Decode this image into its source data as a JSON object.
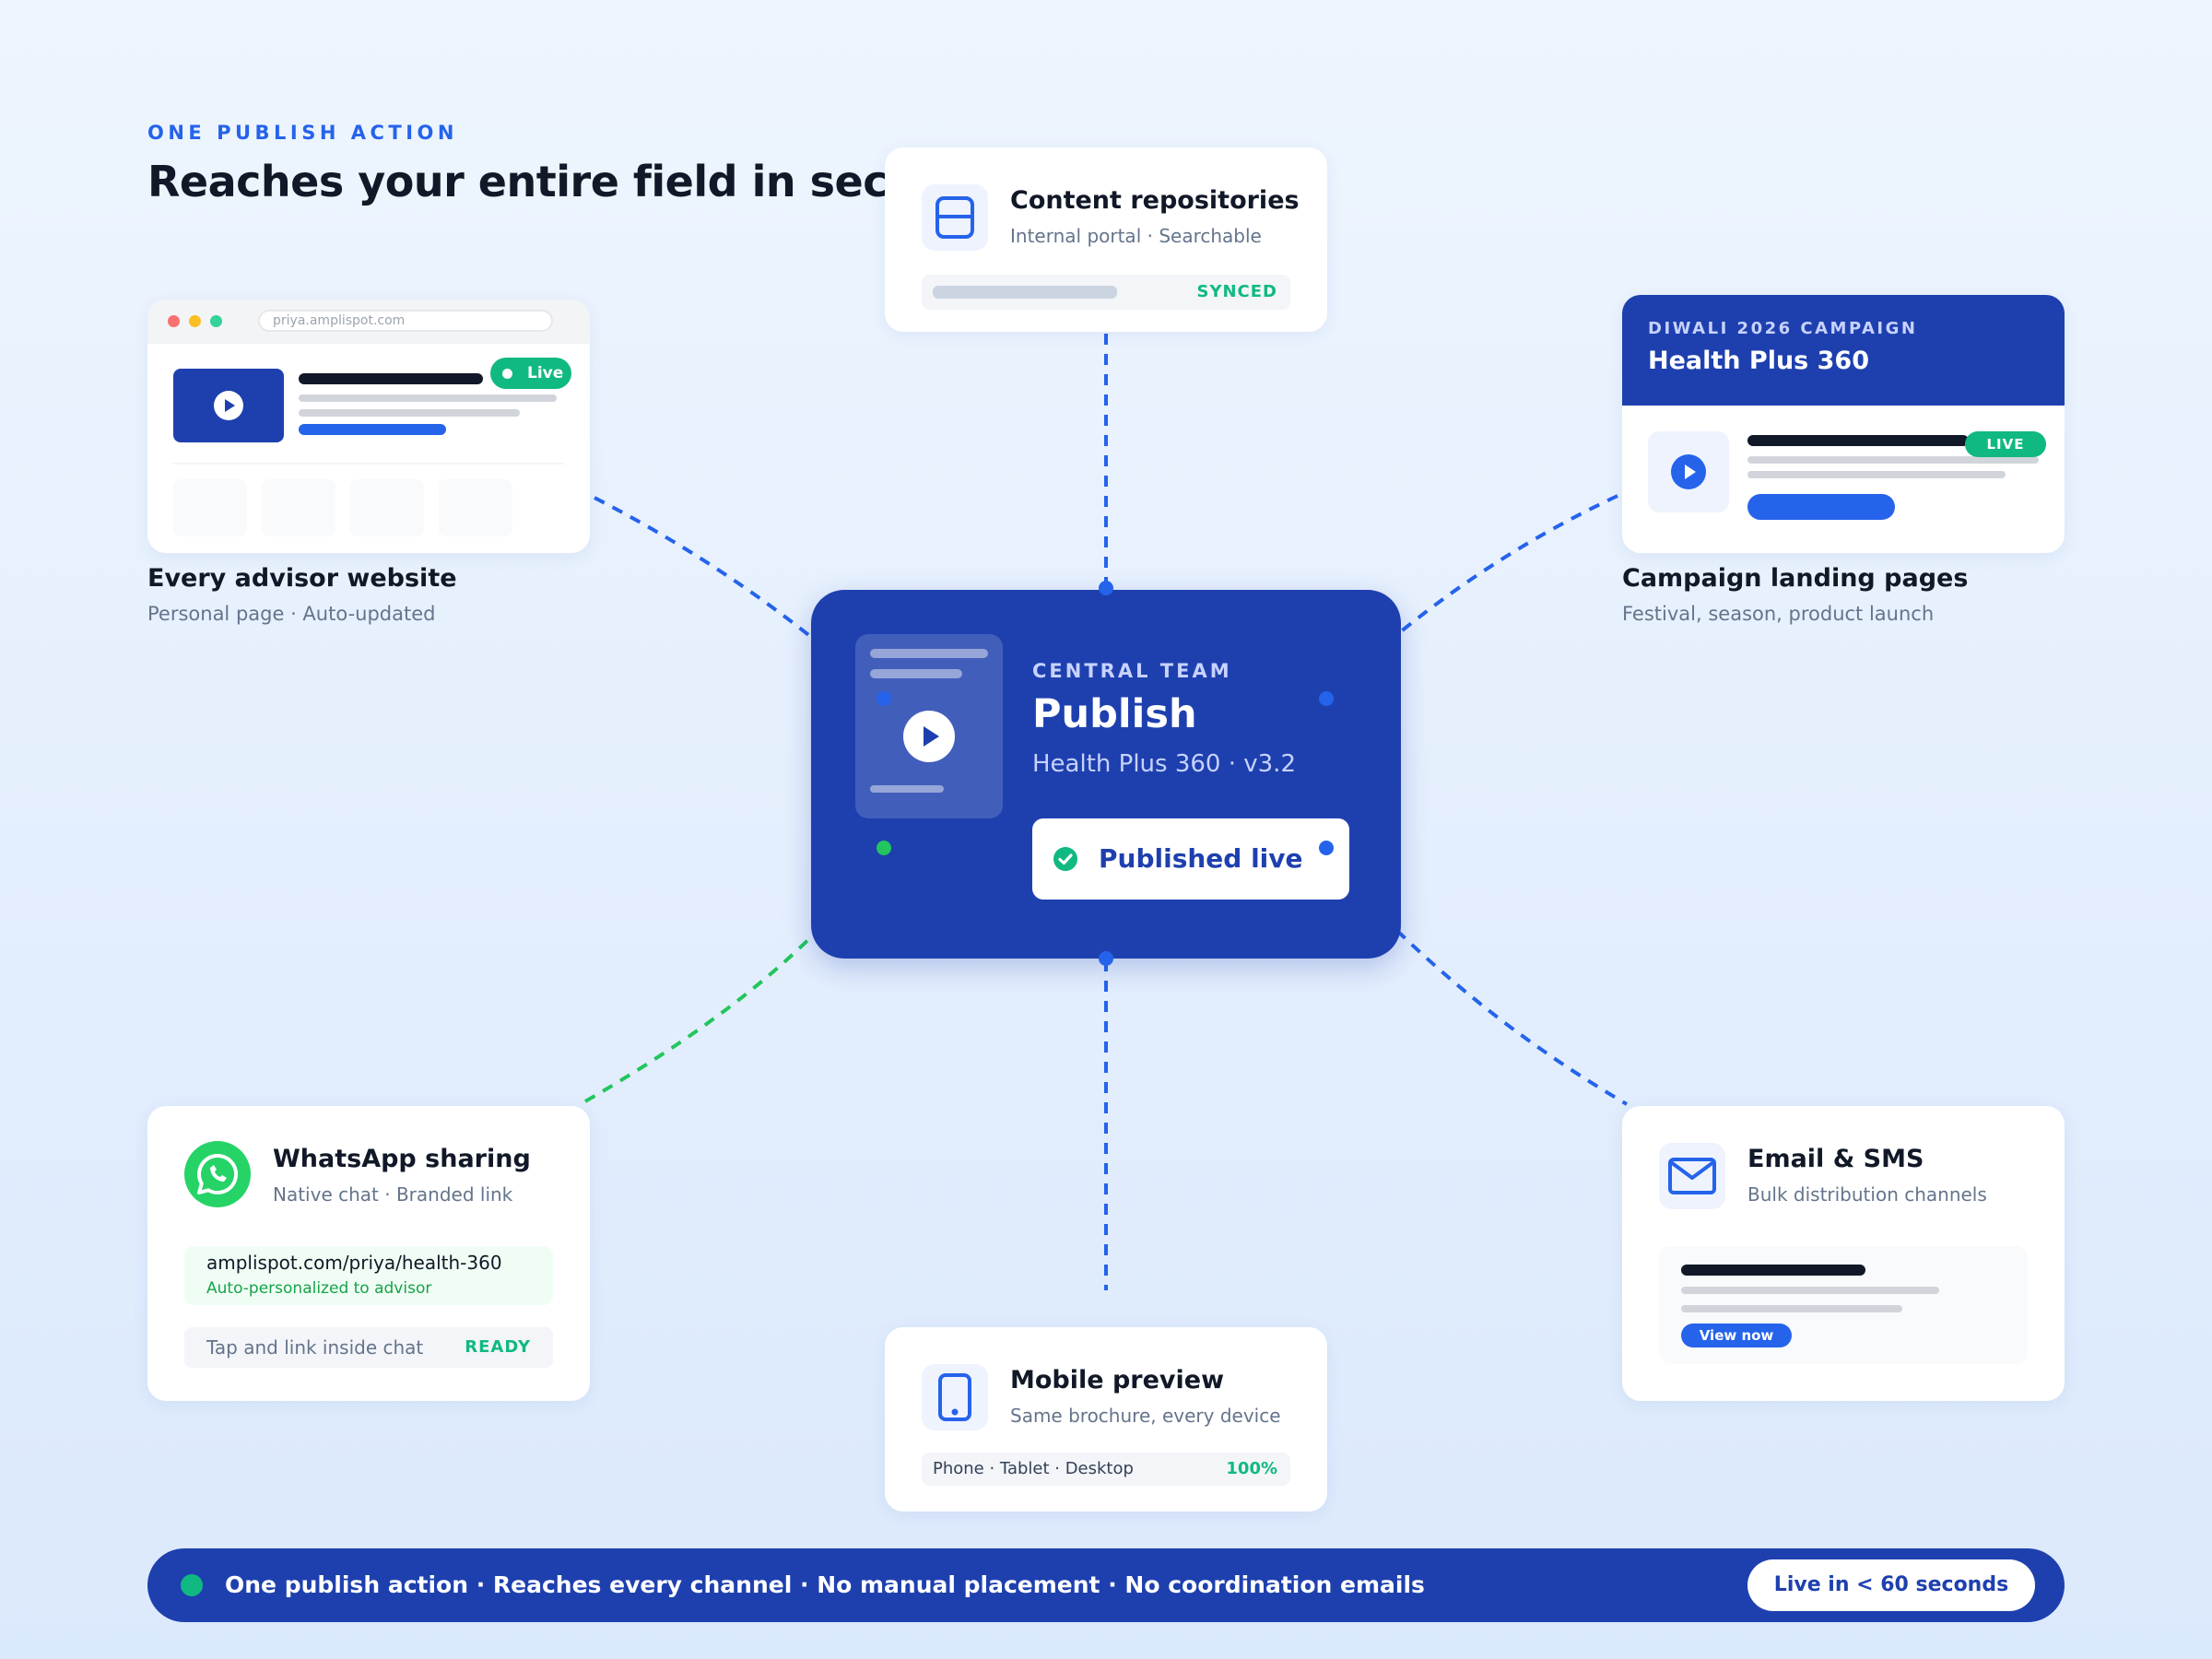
{
  "header": {
    "eyebrow": "ONE PUBLISH ACTION",
    "headline": "Reaches your entire field in seconds."
  },
  "central": {
    "eyebrow": "CENTRAL TEAM",
    "title": "Publish",
    "subtitle": "Health Plus 360 · v3.2",
    "button_label": "Published live",
    "doc_icon": "play-icon"
  },
  "content_repositories": {
    "title": "Content repositories",
    "subtitle": "Internal portal · Searchable",
    "status": "SYNCED",
    "icon": "layout-icon"
  },
  "advisor_website": {
    "url": "priya.amplispot.com",
    "badge": "Live",
    "title": "Every advisor website",
    "subtitle": "Personal page · Auto-updated"
  },
  "campaign": {
    "eyebrow": "DIWALI 2026 CAMPAIGN",
    "name": "Health Plus 360",
    "badge": "LIVE",
    "title": "Campaign landing pages",
    "subtitle": "Festival, season, product launch"
  },
  "whatsapp": {
    "title": "WhatsApp sharing",
    "subtitle": "Native chat · Branded link",
    "link": "amplispot.com/priya/health-360",
    "link_note": "Auto-personalized to advisor",
    "action_text": "Tap and link inside chat",
    "status": "READY",
    "icon": "whatsapp-icon"
  },
  "mobile": {
    "title": "Mobile preview",
    "subtitle": "Same brochure, every device",
    "devices": "Phone · Tablet · Desktop",
    "percent": "100%",
    "icon": "phone-icon"
  },
  "email": {
    "title": "Email & SMS",
    "subtitle": "Bulk distribution channels",
    "button": "View now",
    "icon": "mail-icon"
  },
  "footer": {
    "text": "One publish action · Reaches every channel · No manual placement · No coordination emails",
    "cta": "Live in < 60 seconds"
  },
  "colors": {
    "brand": "#1e40af",
    "accent": "#2563eb",
    "success": "#10b981",
    "whatsapp": "#25d366"
  }
}
